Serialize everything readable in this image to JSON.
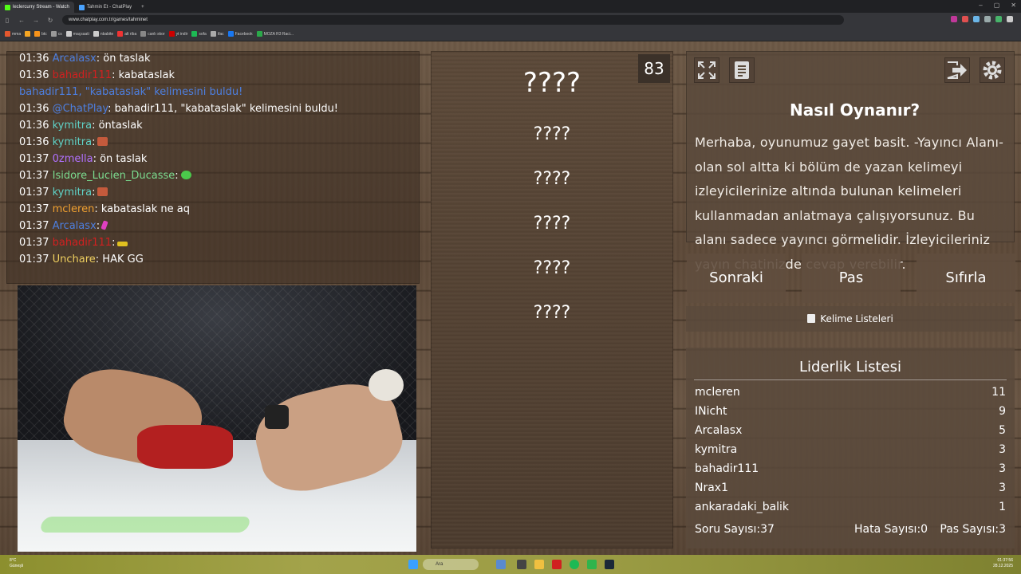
{
  "browser": {
    "tabs": [
      {
        "label": "leclercurry Stream - Watch",
        "color": "#53fc18",
        "active": true
      },
      {
        "label": "Tahmin Et - ChatPlay",
        "color": "#4aa3ff",
        "active": false
      }
    ],
    "url": "www.chatplay.com.tr/games/tahminet",
    "bookmarks": [
      "mma",
      "btc",
      "cs",
      "maçsaati",
      "nbabite",
      "alt riba",
      "canlı skor",
      "yt indir",
      "sofa",
      "ifac",
      "Facebook",
      "MOZA R3 Raci..."
    ]
  },
  "chat": [
    {
      "time": "01:36",
      "user": "Arcalasx",
      "user_color": "#4d7fe0",
      "msg": ": ön taslak"
    },
    {
      "time": "01:36",
      "user": "bahadir111",
      "user_color": "#d12020",
      "msg": ": kabataslak"
    },
    {
      "time": "",
      "user": "bahadir111, \"kabataslak\" kelimesini buldu!",
      "user_color": "#4d7fe0",
      "msg": ""
    },
    {
      "time": "01:36",
      "user": "@ChatPlay",
      "user_color": "#4d7fe0",
      "msg": ": bahadir111, \"kabataslak\" kelimesini buldu!"
    },
    {
      "time": "01:36",
      "user": "kymitra",
      "user_color": "#5fd3c8",
      "msg": ": öntaslak"
    },
    {
      "time": "01:36",
      "user": "kymitra",
      "user_color": "#5fd3c8",
      "msg": ":"
    },
    {
      "time": "01:37",
      "user": "0zmella",
      "user_color": "#b070ff",
      "msg": ": ön taslak"
    },
    {
      "time": "01:37",
      "user": "Isidore_Lucien_Ducasse",
      "user_color": "#7bdc8f",
      "msg": ":"
    },
    {
      "time": "01:37",
      "user": "kymitra",
      "user_color": "#5fd3c8",
      "msg": ":"
    },
    {
      "time": "01:37",
      "user": "mcleren",
      "user_color": "#f0a030",
      "msg": ": kabataslak ne aq"
    },
    {
      "time": "01:37",
      "user": "Arcalasx",
      "user_color": "#4d7fe0",
      "msg": ":"
    },
    {
      "time": "01:37",
      "user": "bahadir111",
      "user_color": "#d12020",
      "msg": ":"
    },
    {
      "time": "01:37",
      "user": "Unchare",
      "user_color": "#f0d060",
      "msg": ": HAK GG"
    }
  ],
  "chat_emotes": [
    "#c45a3c",
    "#4bc94b",
    "#c45a3c",
    "#e040c0",
    "#e0c020"
  ],
  "game": {
    "timer": "83",
    "words": [
      "????",
      "????",
      "????",
      "????",
      "????",
      "????"
    ],
    "help_title": "Nasıl Oynanır?",
    "help_text": "Merhaba, oyunumuz gayet basit. -Yayıncı Alanı- olan sol altta ki bölüm de yazan kelimeyi izleyicilerinize altında bulunan kelimeleri kullanmadan anlatmaya çalışıyorsunuz. Bu alanı sadece yayıncı görmelidir. İzleyicileriniz yayın chatinizde cevap verebilir.",
    "buttons": {
      "next": "Sonraki",
      "pass": "Pas",
      "reset": "Sıfırla"
    },
    "word_lists": "Kelime Listeleri"
  },
  "leaderboard": {
    "title": "Liderlik Listesi",
    "rows": [
      {
        "name": "mcleren",
        "score": "11"
      },
      {
        "name": "INicht",
        "score": "9"
      },
      {
        "name": "Arcalasx",
        "score": "5"
      },
      {
        "name": "kymitra",
        "score": "3"
      },
      {
        "name": "bahadir111",
        "score": "3"
      },
      {
        "name": "Nrax1",
        "score": "3"
      },
      {
        "name": "ankaradaki_balik",
        "score": "1"
      }
    ],
    "stats": {
      "questions_label": "Soru Sayısı:",
      "questions": "37",
      "errors_label": "Hata Sayısı:",
      "errors": "0",
      "passes_label": "Pas Sayısı:",
      "passes": "3"
    }
  },
  "taskbar": {
    "weather_temp": "8°C",
    "weather_text": "Güneşli",
    "search": "Ara",
    "time": "01:37:56",
    "date": "28.12.2025"
  }
}
